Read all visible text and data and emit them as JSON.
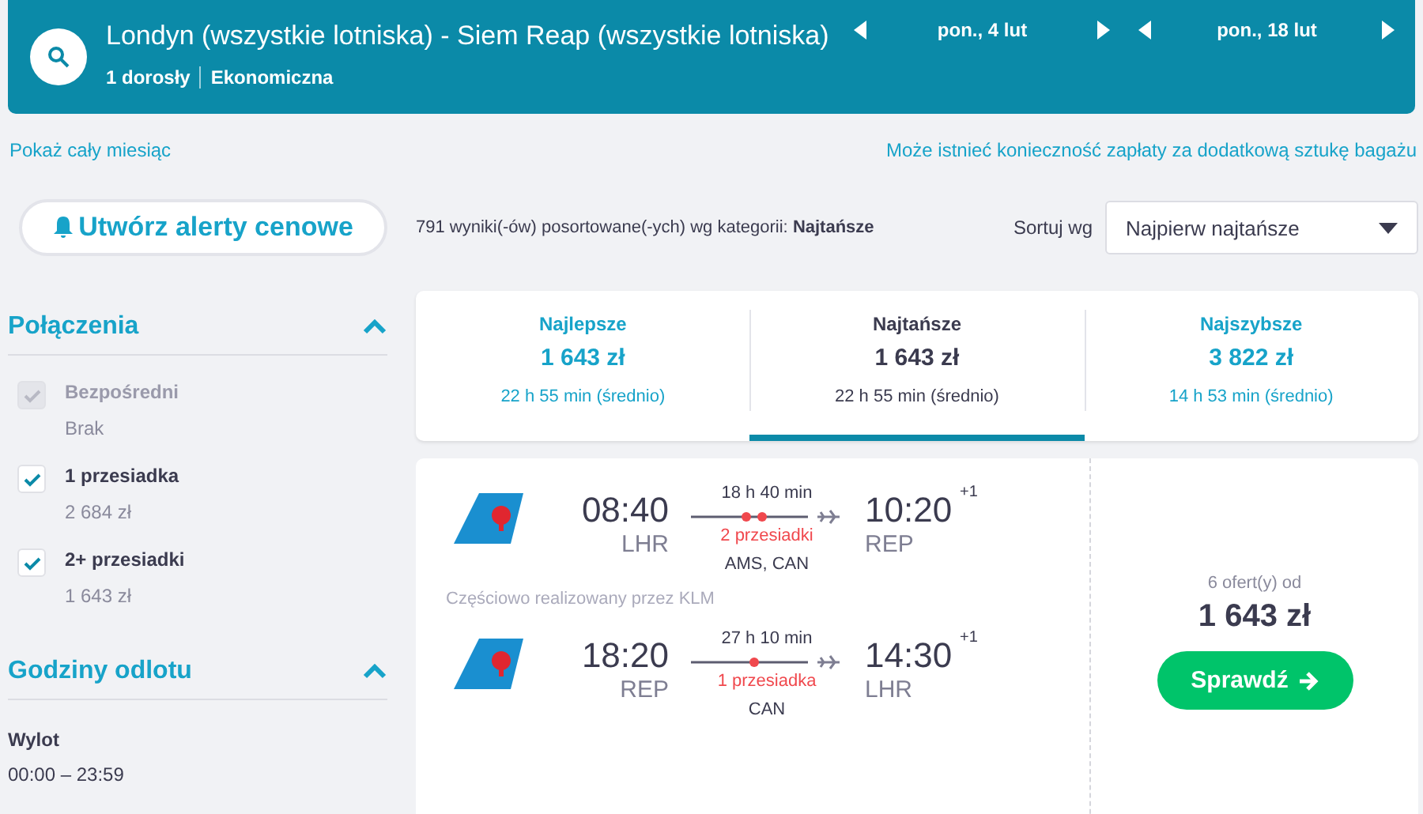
{
  "search_bar": {
    "route": "Londyn (wszystkie lotniska) - Siem Reap (wszystkie lotniska)",
    "passengers": "1 dorosły",
    "cabin": "Ekonomiczna",
    "dates": [
      {
        "label": "pon., 4 lut"
      },
      {
        "label": "pon., 18 lut"
      }
    ]
  },
  "links": {
    "month": "Pokaż cały miesiąc",
    "baggage": "Może istnieć konieczność zapłaty za dodatkową sztukę bagażu"
  },
  "alert_button": "Utwórz alerty cenowe",
  "results_summary": {
    "text": "791 wyniki(-ów) posortowane(-ych) wg kategorii: **Najtańsze**",
    "sort_label": "Sortuj wg",
    "sort_value": "Najpierw najtańsze"
  },
  "filters": [
    {
      "title": "Połączenia",
      "expanded": true,
      "items": [
        {
          "kind": "checkbox",
          "label": "Bezpośredni",
          "sub": "Brak",
          "checked": true,
          "disabled": true
        },
        {
          "kind": "checkbox",
          "label": "1 przesiadka",
          "sub": "2 684 zł",
          "checked": true,
          "disabled": false
        },
        {
          "kind": "checkbox",
          "label": "2+ przesiadki",
          "sub": "1 643 zł",
          "checked": true,
          "disabled": false
        }
      ]
    },
    {
      "title": "Godziny odlotu",
      "expanded": true,
      "items": [
        {
          "kind": "range",
          "label": "Wylot",
          "sub": "00:00 – 23:59"
        }
      ]
    }
  ],
  "sort_tabs": [
    {
      "label": "Najlepsze",
      "price": "1 643 zł",
      "duration": "22 h 55 min (średnio)",
      "selected": false
    },
    {
      "label": "Najtańsze",
      "price": "1 643 zł",
      "duration": "22 h 55 min (średnio)",
      "selected": true
    },
    {
      "label": "Najszybsze",
      "price": "3 822 zł",
      "duration": "14 h 53 min (średnio)",
      "selected": false
    }
  ],
  "result": {
    "legs": [
      {
        "depart": "08:40",
        "from": "LHR",
        "duration": "18 h 40 min",
        "stops_label": "2 przesiadki",
        "via": "AMS, CAN",
        "arrive": "10:20",
        "day_offset": "+1",
        "to": "REP"
      },
      {
        "depart": "18:20",
        "from": "REP",
        "duration": "27 h 10 min",
        "stops_label": "1 przesiadka",
        "via": "CAN",
        "arrive": "14:30",
        "day_offset": "+1",
        "to": "LHR"
      }
    ],
    "operated_note": "Częściowo realizowany przez KLM",
    "offers": "6 ofert(y) od",
    "price": "1 643 zł",
    "cta": "Sprawdź"
  }
}
